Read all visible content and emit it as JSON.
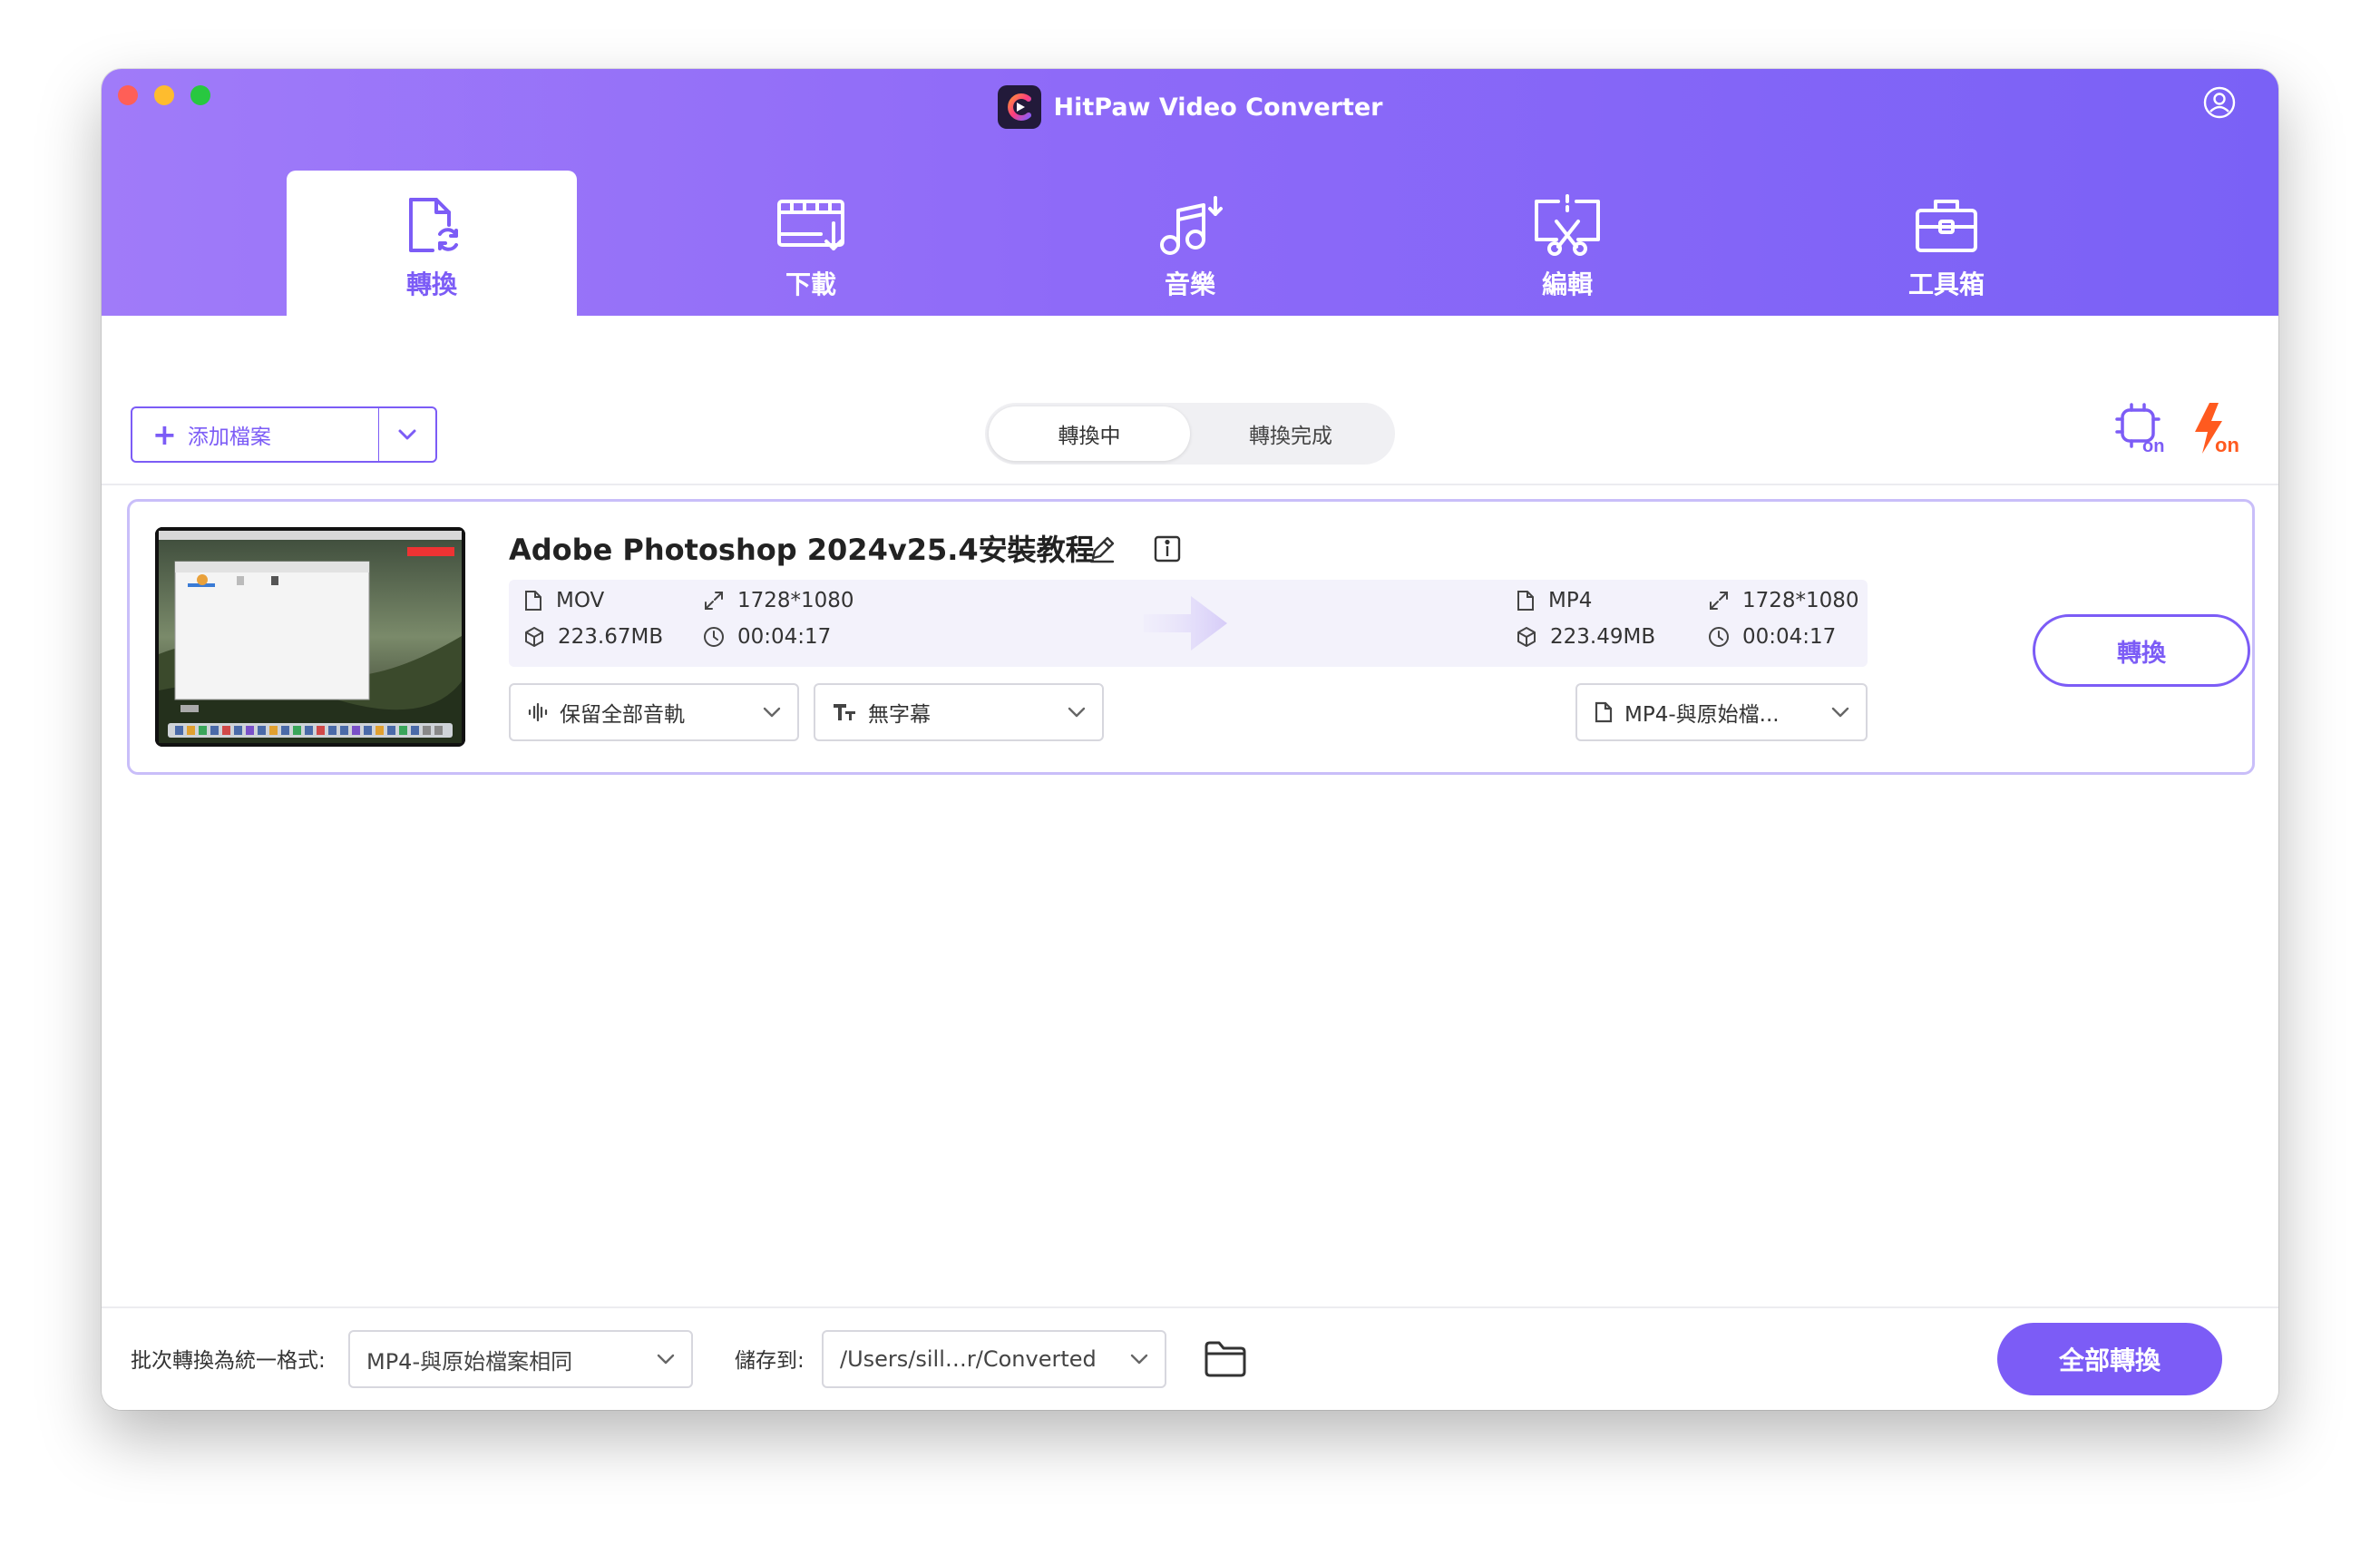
{
  "app": {
    "title": "HitPaw Video Converter"
  },
  "tabs": [
    {
      "label": "轉換",
      "icon": "convert-file-icon",
      "active": true
    },
    {
      "label": "下載",
      "icon": "download-film-icon",
      "active": false
    },
    {
      "label": "音樂",
      "icon": "music-note-icon",
      "active": false
    },
    {
      "label": "編輯",
      "icon": "edit-scissors-icon",
      "active": false
    },
    {
      "label": "工具箱",
      "icon": "toolbox-icon",
      "active": false
    }
  ],
  "toolbar": {
    "add_files_label": "添加檔案",
    "segments": {
      "converting": "轉換中",
      "converted": "轉換完成"
    },
    "hw_accel_badge": "on",
    "lightning_badge": "on"
  },
  "file": {
    "title": "Adobe Photoshop 2024v25.4安裝教程",
    "source": {
      "format": "MOV",
      "resolution": "1728*1080",
      "size": "223.67MB",
      "duration": "00:04:17"
    },
    "target": {
      "format": "MP4",
      "resolution": "1728*1080",
      "size": "223.49MB",
      "duration": "00:04:17"
    },
    "audio_track": "保留全部音軌",
    "subtitle": "無字幕",
    "output_format": "MP4-與原始檔...",
    "convert_label": "轉換"
  },
  "footer": {
    "batch_label": "批次轉換為統一格式:",
    "batch_value": "MP4-與原始檔案相同",
    "save_label": "儲存到:",
    "save_path": "/Users/sill…r/Converted",
    "convert_all_label": "全部轉換"
  },
  "colors": {
    "accent": "#7c5cf6",
    "header_start": "#a07bf9",
    "header_end": "#7a61f6",
    "lightning": "#ff5a1f"
  }
}
